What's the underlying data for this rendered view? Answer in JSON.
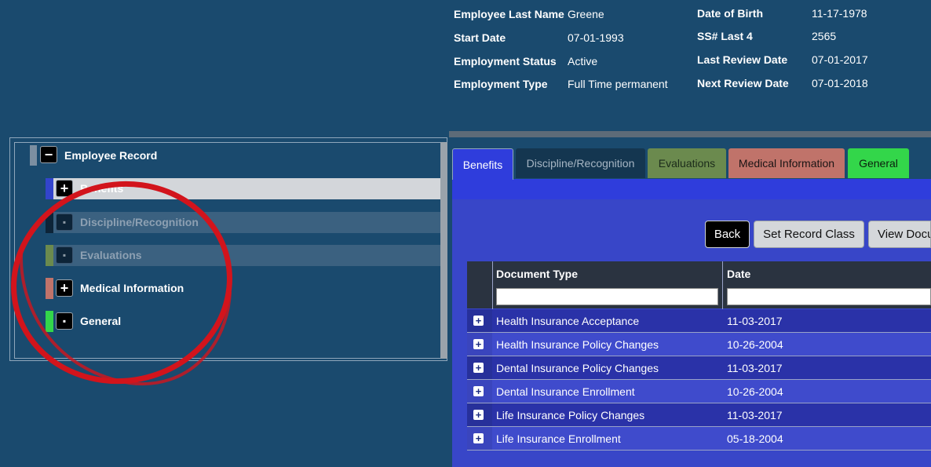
{
  "employee": {
    "last_name_label": "Employee Last Name",
    "last_name": "Greene",
    "start_date_label": "Start Date",
    "start_date": "07-01-1993",
    "status_label": "Employment Status",
    "status": "Active",
    "type_label": "Employment Type",
    "type": "Full Time permanent",
    "dob_label": "Date of Birth",
    "dob": "11-17-1978",
    "ssn_label": "SS# Last 4",
    "ssn": "2565",
    "last_review_label": "Last Review Date",
    "last_review": "07-01-2017",
    "next_review_label": "Next Review Date",
    "next_review": "07-01-2018"
  },
  "tree": {
    "root": {
      "label": "Employee Record",
      "toggle": "−"
    },
    "items": [
      {
        "label": "Benefits",
        "toggle": "+",
        "band_color": "#3344cc"
      },
      {
        "label": "Discipline/Recognition",
        "toggle": "▪",
        "band_color": "#0d2438"
      },
      {
        "label": "Evaluations",
        "toggle": "▪",
        "band_color": "#6b8a4e"
      },
      {
        "label": "Medical Information",
        "toggle": "+",
        "band_color": "#c0736a"
      },
      {
        "label": "General",
        "toggle": "▪",
        "band_color": "#33d64a"
      }
    ]
  },
  "tabs": [
    {
      "label": "Benefits",
      "color": "#2f3ddc"
    },
    {
      "label": "Discipline/Recognition",
      "color": "#143650"
    },
    {
      "label": "Evaluations",
      "color": "#6b8a4e"
    },
    {
      "label": "Medical Information",
      "color": "#c0736a"
    },
    {
      "label": "General",
      "color": "#33d64a"
    }
  ],
  "toolbar": {
    "back_label": "Back",
    "set_record_class_label": "Set Record Class",
    "view_documents_label": "View Docu"
  },
  "grid": {
    "columns": [
      "Document Type",
      "Date"
    ],
    "rows": [
      {
        "document_type": "Health Insurance Acceptance",
        "date": "11-03-2017"
      },
      {
        "document_type": "Health Insurance Policy Changes",
        "date": "10-26-2004"
      },
      {
        "document_type": "Dental Insurance Policy Changes",
        "date": "11-03-2017"
      },
      {
        "document_type": "Dental Insurance Enrollment",
        "date": "10-26-2004"
      },
      {
        "document_type": "Life Insurance Policy Changes",
        "date": "11-03-2017"
      },
      {
        "document_type": "Life Insurance Enrollment",
        "date": "05-18-2004"
      }
    ]
  },
  "colors": {
    "page_bg": "#1a4a6e",
    "annotation_circle": "#d2141c"
  }
}
